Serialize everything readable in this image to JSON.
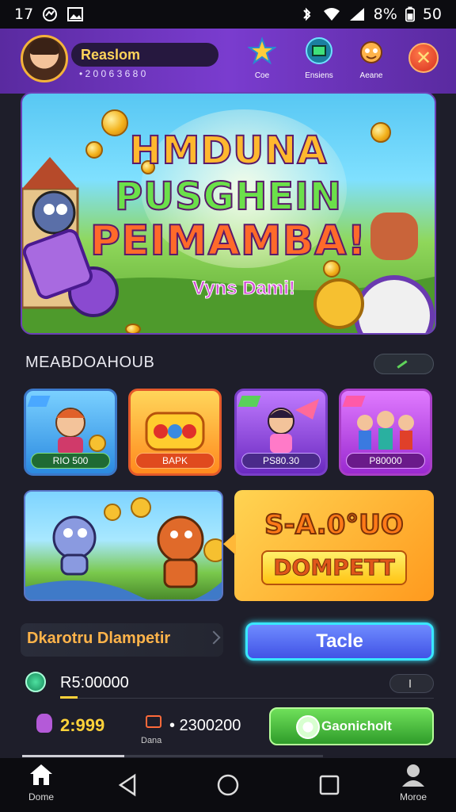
{
  "status_bar": {
    "time": "1",
    "time_suffix": "7",
    "battery": "8%",
    "signal_text": "50"
  },
  "header": {
    "player_name": "Reaslom",
    "player_sub": "• 2 0 0 6 3 6 8 0",
    "icons": [
      {
        "label": "Coe",
        "icon": "star-icon"
      },
      {
        "label": "Ensiens",
        "icon": "store-icon"
      },
      {
        "label": "Aeane",
        "icon": "mascot-icon"
      }
    ],
    "close": "✕"
  },
  "hero": {
    "title_line1": "HMDUNA",
    "title_line2": "PUSGHEIN",
    "title_line3": "PEIMAMBA!",
    "subtitle": "Vyns Dami!"
  },
  "section": {
    "title": "MEABDOAHOUB"
  },
  "games": [
    {
      "tag": "RIO 500",
      "color": "#3b78c9"
    },
    {
      "tag": "BAPK",
      "color": "#e3592a"
    },
    {
      "tag": "PS80.30",
      "color": "#7a3fc8"
    },
    {
      "tag": "P80000",
      "color": "#a83ec6"
    }
  ],
  "promo": {
    "line1": "S-A.0°UO",
    "line2": "DOMPETT"
  },
  "banner": {
    "text": "Dkarotru Dlampetir"
  },
  "buttons": {
    "primary": "Tacle",
    "green": "Gaonicholt"
  },
  "balance": {
    "value": "R5:00000"
  },
  "stats": {
    "gems": "2:999",
    "coins": "• 2300200",
    "coins_label": "Dana"
  },
  "progress": {
    "fraction": 0.34
  },
  "bottom_nav": [
    {
      "label": "Dome",
      "icon": "home-icon"
    },
    {
      "label": "",
      "icon": "back-icon"
    },
    {
      "label": "",
      "icon": "home-circle-icon"
    },
    {
      "label": "",
      "icon": "recents-icon"
    },
    {
      "label": "Moroe",
      "icon": "profile-icon"
    }
  ]
}
